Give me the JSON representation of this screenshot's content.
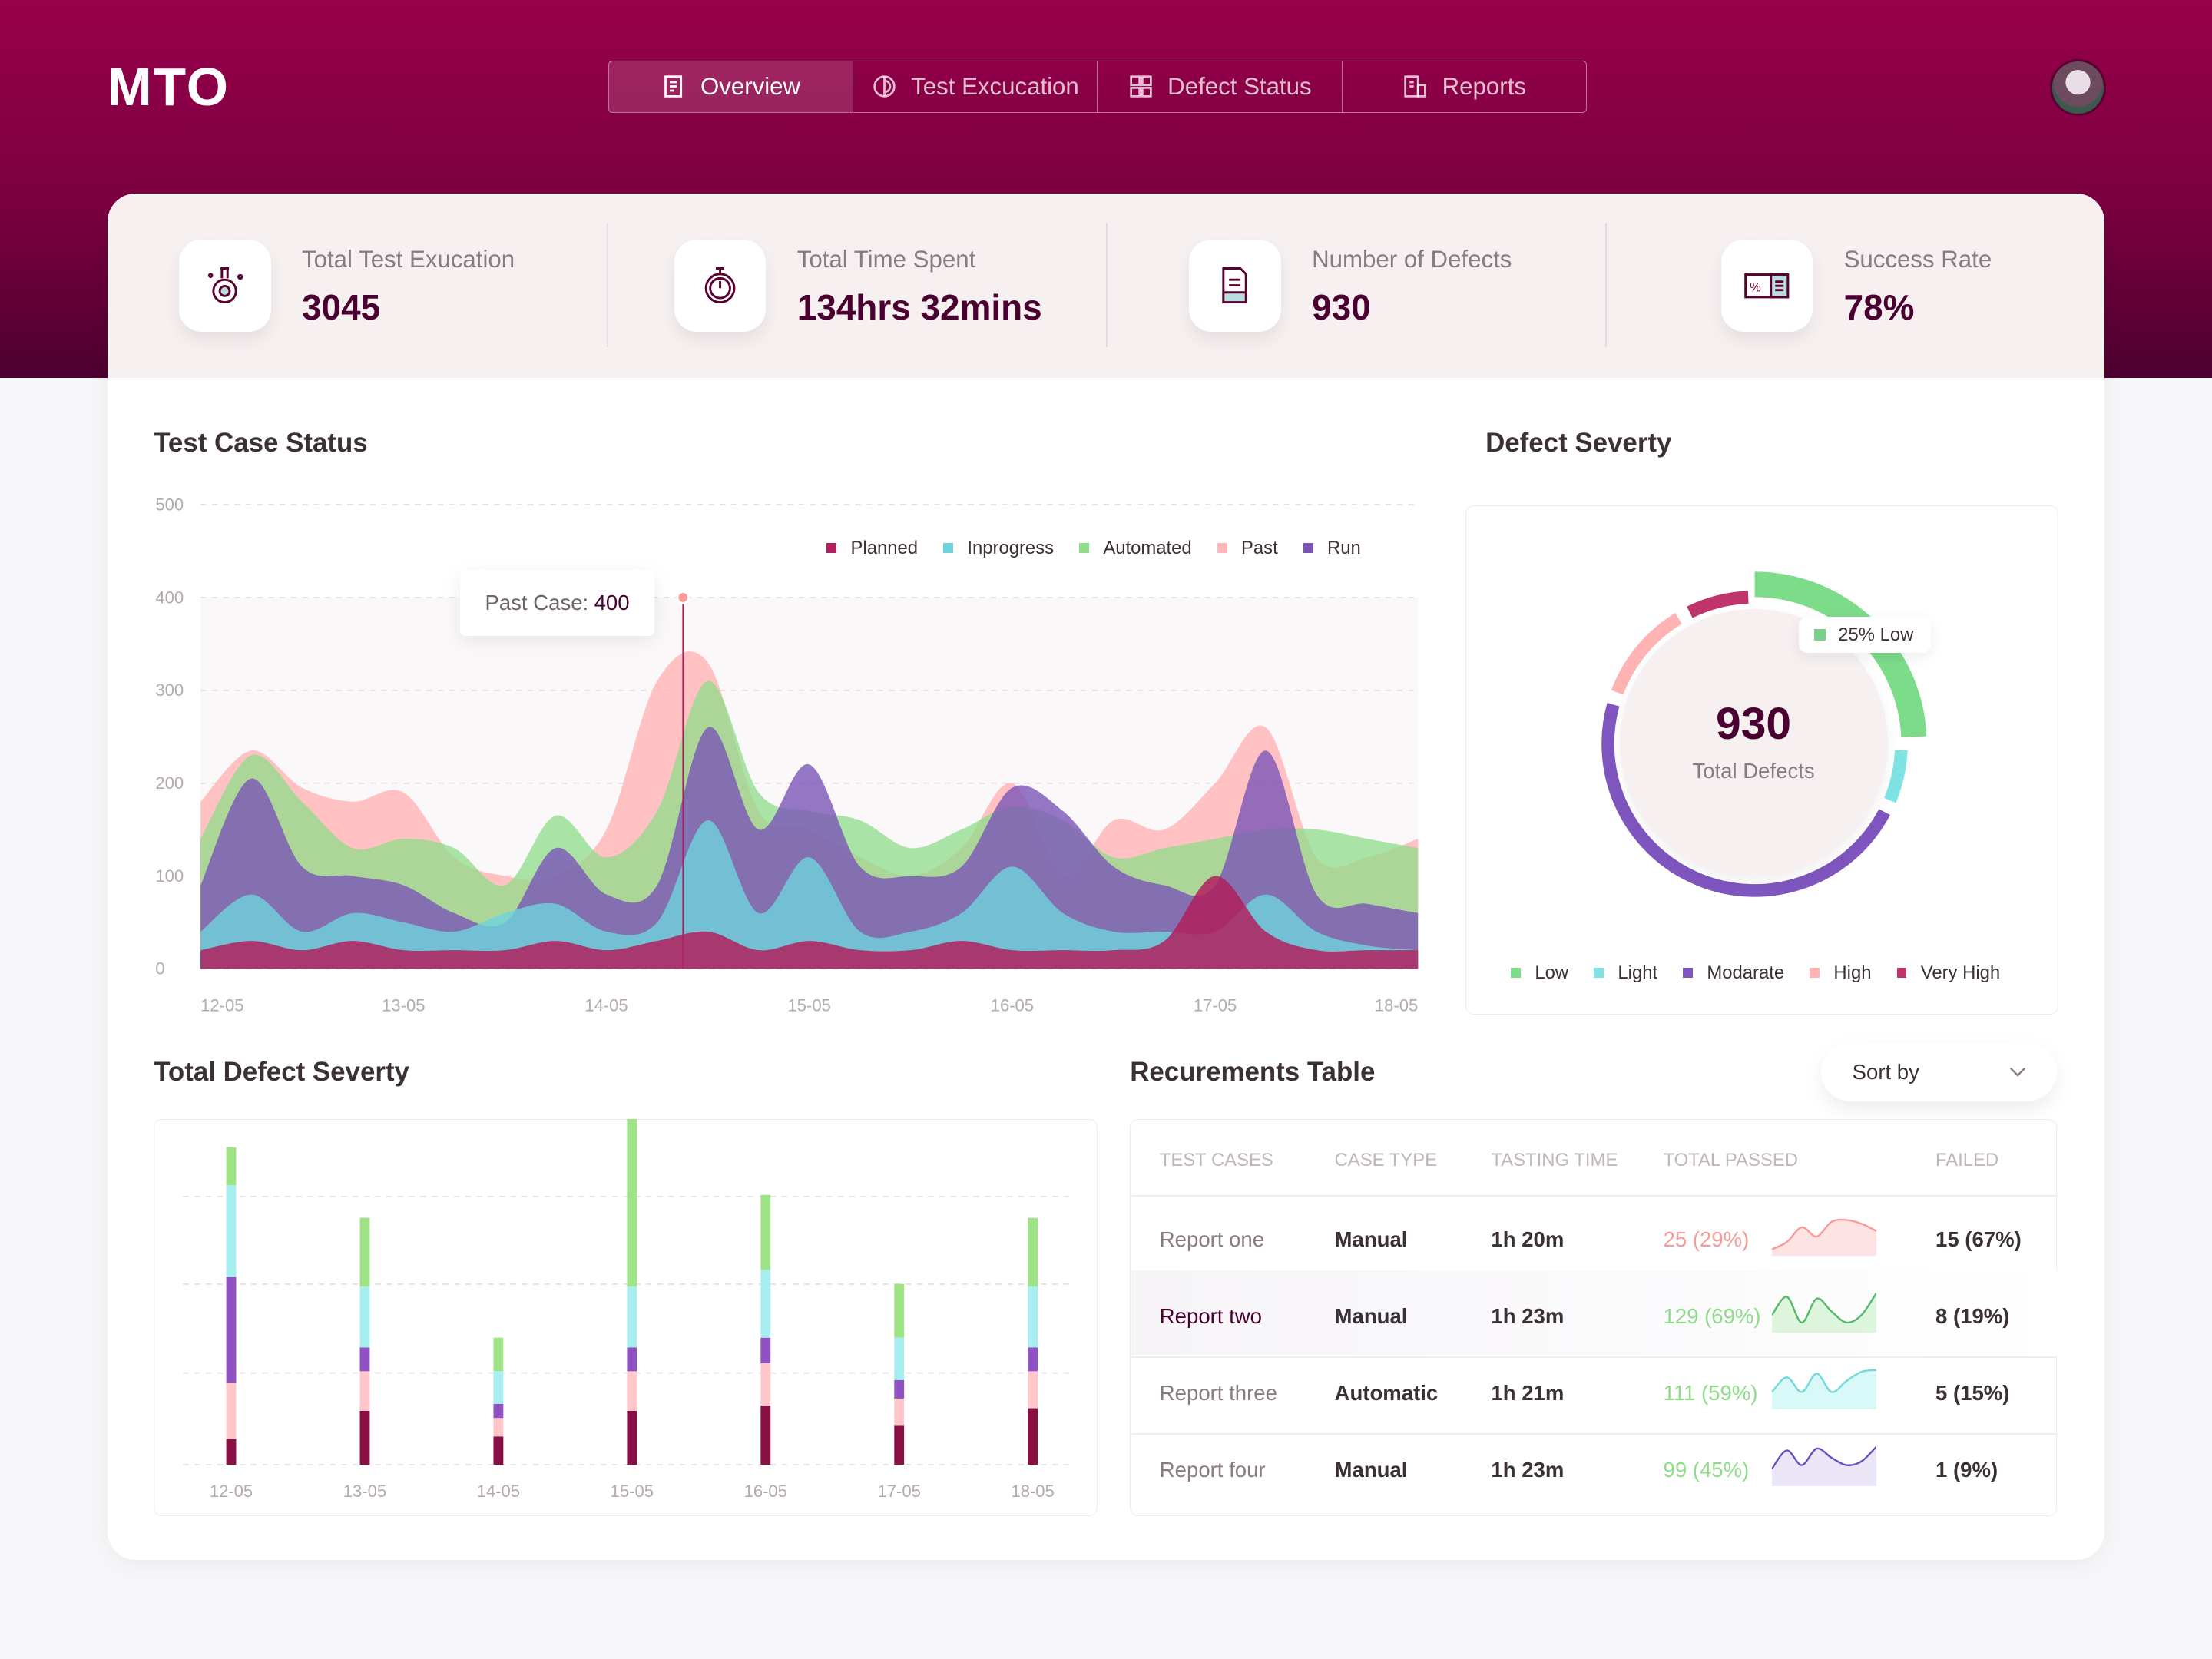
{
  "app": {
    "logo": "MTO"
  },
  "nav": {
    "tabs": [
      {
        "label": "Overview",
        "icon": "document-icon",
        "active": true
      },
      {
        "label": "Test Excucation",
        "icon": "half-circle-icon"
      },
      {
        "label": "Defect Status",
        "icon": "grid-icon"
      },
      {
        "label": "Reports",
        "icon": "report-icon"
      }
    ]
  },
  "stats": [
    {
      "label": "Total Test Exucation",
      "value": "3045",
      "icon": "flask-gear-icon"
    },
    {
      "label": "Total Time Spent",
      "value": "134hrs 32mins",
      "icon": "stopwatch-icon"
    },
    {
      "label": "Number of Defects",
      "value": "930",
      "icon": "receipt-icon"
    },
    {
      "label": "Success Rate",
      "value": "78%",
      "icon": "percent-ticket-icon"
    }
  ],
  "test_case_status": {
    "title": "Test Case Status",
    "tooltip": {
      "label": "Past Case:",
      "value": "400"
    }
  },
  "defect_severity": {
    "title": "Defect Severty",
    "total": "930",
    "total_label": "Total Defects",
    "callout": "25% Low"
  },
  "total_defect_severity": {
    "title": "Total Defect Severty"
  },
  "table": {
    "title": "Recurements Table",
    "sort_label": "Sort by",
    "columns": [
      "TEST CASES",
      "CASE TYPE",
      "TASTING TIME",
      "TOTAL PASSED",
      "FAILED"
    ],
    "rows": [
      {
        "name": "Report one",
        "type": "Manual",
        "time": "1h 20m",
        "passed": "25 (29%)",
        "failed": "15 (67%)",
        "trend": [
          10,
          30,
          70,
          45,
          85,
          90,
          80,
          60
        ],
        "color": "#f79a9a",
        "fill": "#fde3e3",
        "highlight": false
      },
      {
        "name": "Report two",
        "type": "Manual",
        "time": "1h 23m",
        "passed": "129 (69%)",
        "failed": "8 (19%)",
        "trend": [
          40,
          90,
          20,
          85,
          50,
          20,
          40,
          100
        ],
        "color": "#55b86a",
        "fill": "#dcf5dc",
        "highlight": true
      },
      {
        "name": "Report three",
        "type": "Automatic",
        "time": "1h 21m",
        "passed": "111 (59%)",
        "failed": "5 (15%)",
        "trend": [
          40,
          80,
          40,
          90,
          40,
          70,
          95,
          100
        ],
        "color": "#6fdad8",
        "fill": "#d9f8f8",
        "highlight": false
      },
      {
        "name": "Report four",
        "type": "Manual",
        "time": "1h 23m",
        "passed": "99 (45%)",
        "failed": "1 (9%)",
        "trend": [
          40,
          90,
          50,
          95,
          70,
          50,
          60,
          100
        ],
        "color": "#6a4fc0",
        "fill": "#ebe6f7",
        "highlight": false
      }
    ]
  },
  "chart_data": [
    {
      "type": "area",
      "title": "Test Case Status",
      "x": [
        "12-05",
        "12-05",
        "12-05",
        "12-05",
        "13-05",
        "13-05",
        "13-05",
        "13-05",
        "14-05",
        "14-05",
        "14-05",
        "14-05",
        "15-05",
        "15-05",
        "15-05",
        "15-05",
        "16-05",
        "16-05",
        "16-05",
        "16-05",
        "17-05",
        "17-05",
        "17-05",
        "17-05",
        "18-05"
      ],
      "xticks": [
        "12-05",
        "13-05",
        "14-05",
        "15-05",
        "16-05",
        "17-05",
        "18-05"
      ],
      "yticks": [
        0,
        100,
        200,
        300,
        400,
        500
      ],
      "ylim": [
        0,
        500
      ],
      "grid": true,
      "legend_position": "top-right",
      "series": [
        {
          "name": "Past",
          "color": "#ffb7b9",
          "values": [
            180,
            235,
            195,
            180,
            190,
            120,
            100,
            100,
            150,
            310,
            330,
            170,
            150,
            120,
            100,
            130,
            200,
            100,
            160,
            150,
            200,
            260,
            120,
            120,
            140
          ]
        },
        {
          "name": "Automated",
          "color": "#8fdc8a",
          "values": [
            140,
            230,
            180,
            130,
            140,
            130,
            90,
            165,
            120,
            170,
            310,
            190,
            170,
            160,
            130,
            150,
            175,
            160,
            120,
            130,
            140,
            150,
            150,
            140,
            130
          ]
        },
        {
          "name": "Run",
          "color": "#7a55b8",
          "values": [
            90,
            205,
            110,
            100,
            90,
            60,
            50,
            130,
            80,
            90,
            260,
            150,
            220,
            110,
            100,
            110,
            195,
            170,
            110,
            90,
            90,
            235,
            80,
            70,
            60
          ]
        },
        {
          "name": "Inprogress",
          "color": "#6fd3dc",
          "values": [
            40,
            80,
            40,
            60,
            50,
            40,
            60,
            70,
            40,
            50,
            160,
            60,
            120,
            40,
            40,
            60,
            110,
            60,
            40,
            40,
            40,
            80,
            40,
            25,
            20
          ]
        },
        {
          "name": "Planned",
          "color": "#b0205e",
          "values": [
            20,
            30,
            20,
            30,
            20,
            20,
            20,
            30,
            20,
            30,
            40,
            20,
            30,
            20,
            20,
            30,
            20,
            20,
            20,
            30,
            100,
            40,
            20,
            20,
            20
          ]
        }
      ],
      "annotation": {
        "series": "Past",
        "value": 400
      }
    },
    {
      "type": "donut",
      "title": "Defect Severty",
      "total": 930,
      "legend_position": "bottom",
      "slices": [
        {
          "name": "Low",
          "percent": 25,
          "color": "#7ddc8a"
        },
        {
          "name": "Light",
          "percent": 7,
          "color": "#7fe3e3"
        },
        {
          "name": "Modarate",
          "percent": 48,
          "color": "#7f55bf"
        },
        {
          "name": "High",
          "percent": 12,
          "color": "#ffb3b3"
        },
        {
          "name": "Very High",
          "percent": 8,
          "color": "#c0336b"
        }
      ]
    },
    {
      "type": "bar",
      "stacked": true,
      "title": "Total Defect Severty",
      "categories": [
        "12-05",
        "13-05",
        "14-05",
        "15-05",
        "16-05",
        "17-05",
        "18-05"
      ],
      "grid": true,
      "series": [
        {
          "name": "Very High",
          "color": "#8a0f45",
          "values": [
            29,
            61,
            32,
            61,
            67,
            45,
            64
          ]
        },
        {
          "name": "High",
          "color": "#ffc7c9",
          "values": [
            64,
            45,
            21,
            45,
            48,
            30,
            42
          ]
        },
        {
          "name": "Modarate",
          "color": "#8e52c2",
          "values": [
            120,
            27,
            16,
            27,
            29,
            21,
            27
          ]
        },
        {
          "name": "Light",
          "color": "#a6eef0",
          "values": [
            104,
            69,
            37,
            69,
            77,
            48,
            69
          ]
        },
        {
          "name": "Low",
          "color": "#9ee486",
          "values": [
            43,
            78,
            38,
            190,
            85,
            61,
            78
          ]
        }
      ]
    }
  ]
}
